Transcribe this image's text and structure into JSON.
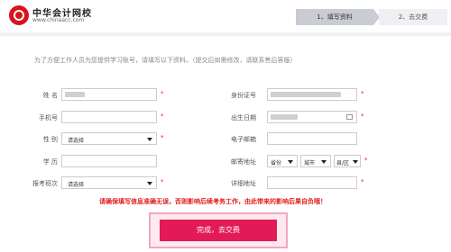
{
  "header": {
    "brand": "中华会计网校",
    "url": "www.chinaacc.com",
    "steps": [
      "1、填写资料",
      "2、去交费"
    ]
  },
  "intro": "为了方便工作人员为您提供学习账号，请填写以下资料。（提交后如需修改，请联系售后客服）",
  "form": {
    "name_label": "姓  名",
    "id_label": "身份证号",
    "phone_label": "手机号",
    "birth_label": "出生日期",
    "gender_label": "性  别",
    "email_label": "电子邮箱",
    "education_label": "学  历",
    "postal_label": "邮寄地址",
    "exam_label": "报考班次",
    "detail_label": "详细地址",
    "gender_value": "请选择",
    "exam_value": "请选择",
    "province": "省份",
    "city": "城市",
    "district": "县/区",
    "required_mark": "*"
  },
  "warning": "请确保填写信息准确无误，否则影响后续考务工作，由此带来的影响后果自负哦！",
  "submit_label": "完成，去交费",
  "colors": {
    "accent": "#e21b57",
    "required": "#e21b1b",
    "brand": "#d6141c"
  }
}
